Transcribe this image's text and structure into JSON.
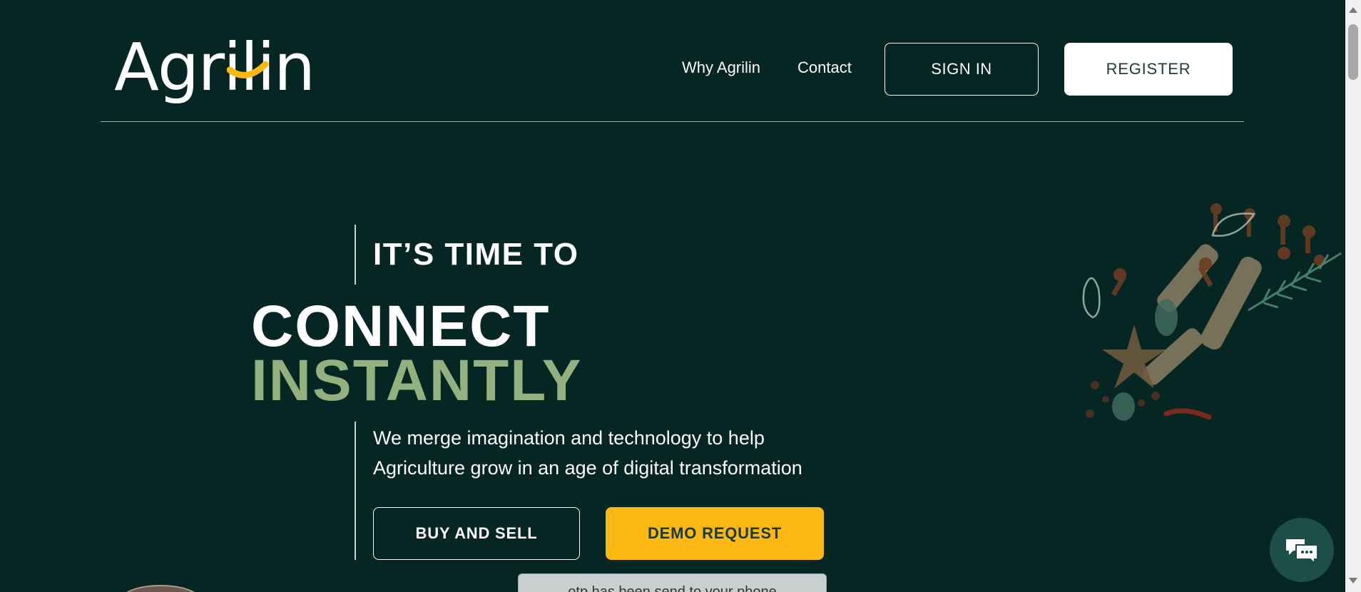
{
  "header": {
    "logo_text": "Agrilin",
    "nav": [
      {
        "label": "Why Agrilin"
      },
      {
        "label": "Contact"
      }
    ],
    "sign_in_label": "SIGN IN",
    "register_label": "REGISTER"
  },
  "hero": {
    "kicker": "IT’S TIME TO",
    "headline_line1": "CONNECT",
    "headline_line2": "INSTANTLY",
    "subtext_line1": "We merge imagination and technology to help",
    "subtext_line2": "Agriculture grow in an age of digital transformation",
    "buy_sell_label": "BUY AND SELL",
    "demo_label": "DEMO REQUEST"
  },
  "toast": {
    "text": "otp has been send to your phone"
  },
  "colors": {
    "background": "#062624",
    "accent_green": "#93b07f",
    "accent_yellow": "#fdb813",
    "white": "#ffffff"
  },
  "icons": {
    "chat": "chat-bubble-icon",
    "decoration": "spices-illustration"
  }
}
